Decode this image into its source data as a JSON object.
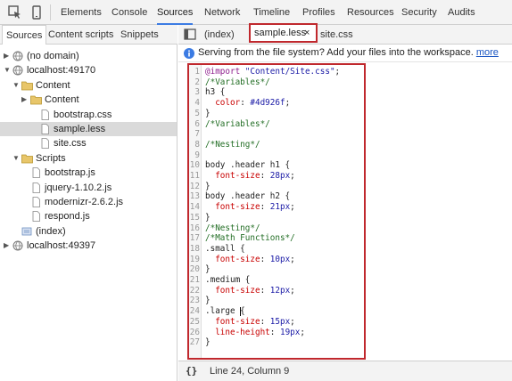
{
  "toolbar": {
    "inspect_icon": "inspect-element-icon",
    "device_icon": "device-mode-icon",
    "tabs": [
      "Elements",
      "Console",
      "Sources",
      "Network",
      "Timeline",
      "Profiles",
      "Resources",
      "Security",
      "Audits"
    ],
    "active_tab": "Sources"
  },
  "navigator": {
    "tabs": [
      "Sources",
      "Content scripts",
      "Snippets"
    ],
    "active_tab": "Sources",
    "tree": [
      {
        "label": "(no domain)",
        "icon": "cloud-icon",
        "arrow": "right"
      },
      {
        "label": "localhost:49170",
        "icon": "cloud-icon",
        "arrow": "down"
      },
      {
        "label": "Content",
        "icon": "folder-icon",
        "arrow": "down"
      },
      {
        "label": "Content",
        "icon": "folder-icon",
        "arrow": "right"
      },
      {
        "label": "bootstrap.css",
        "icon": "file-icon",
        "arrow": ""
      },
      {
        "label": "sample.less",
        "icon": "file-icon",
        "arrow": "",
        "selected": true
      },
      {
        "label": "site.css",
        "icon": "file-icon",
        "arrow": ""
      },
      {
        "label": "Scripts",
        "icon": "folder-icon",
        "arrow": "down"
      },
      {
        "label": "bootstrap.js",
        "icon": "file-icon",
        "arrow": ""
      },
      {
        "label": "jquery-1.10.2.js",
        "icon": "file-icon",
        "arrow": ""
      },
      {
        "label": "modernizr-2.6.2.js",
        "icon": "file-icon",
        "arrow": ""
      },
      {
        "label": "respond.js",
        "icon": "file-icon",
        "arrow": ""
      },
      {
        "label": "(index)",
        "icon": "document-icon",
        "arrow": ""
      },
      {
        "label": "localhost:49397",
        "icon": "cloud-icon",
        "arrow": "right"
      }
    ]
  },
  "editor": {
    "toggle_icon": "toggle-navigator-icon",
    "tabs": [
      {
        "label": "(index)"
      },
      {
        "label": "sample.less",
        "close": "×",
        "active": true
      },
      {
        "label": "site.css"
      }
    ],
    "info_icon": "info-icon",
    "info_text": "Serving from the file system? Add your files into the workspace.",
    "info_link": "more",
    "lines": [
      [
        {
          "t": "@import",
          "c": "at"
        },
        {
          "t": " ",
          "c": "sel"
        },
        {
          "t": "\"Content/Site.css\"",
          "c": "str"
        },
        {
          "t": ";",
          "c": "sel"
        }
      ],
      [
        {
          "t": "/*Variables*/",
          "c": "com"
        }
      ],
      [
        {
          "t": "h3 {",
          "c": "sel"
        }
      ],
      [
        {
          "t": "  color",
          "c": "prop"
        },
        {
          "t": ": ",
          "c": "sel"
        },
        {
          "t": "#4d926f",
          "c": "val"
        },
        {
          "t": ";",
          "c": "sel"
        }
      ],
      [
        {
          "t": "}",
          "c": "sel"
        }
      ],
      [
        {
          "t": "/*Variables*/",
          "c": "com"
        }
      ],
      [],
      [
        {
          "t": "/*Nesting*/",
          "c": "com"
        }
      ],
      [],
      [
        {
          "t": "body .header h1 {",
          "c": "sel"
        }
      ],
      [
        {
          "t": "  font-size",
          "c": "prop"
        },
        {
          "t": ": ",
          "c": "sel"
        },
        {
          "t": "28px",
          "c": "val"
        },
        {
          "t": ";",
          "c": "sel"
        }
      ],
      [
        {
          "t": "}",
          "c": "sel"
        }
      ],
      [
        {
          "t": "body .header h2 {",
          "c": "sel"
        }
      ],
      [
        {
          "t": "  font-size",
          "c": "prop"
        },
        {
          "t": ": ",
          "c": "sel"
        },
        {
          "t": "21px",
          "c": "val"
        },
        {
          "t": ";",
          "c": "sel"
        }
      ],
      [
        {
          "t": "}",
          "c": "sel"
        }
      ],
      [
        {
          "t": "/*Nesting*/",
          "c": "com"
        }
      ],
      [
        {
          "t": "/*Math Functions*/",
          "c": "com"
        }
      ],
      [
        {
          "t": ".small {",
          "c": "sel"
        }
      ],
      [
        {
          "t": "  font-size",
          "c": "prop"
        },
        {
          "t": ": ",
          "c": "sel"
        },
        {
          "t": "10px",
          "c": "val"
        },
        {
          "t": ";",
          "c": "sel"
        }
      ],
      [
        {
          "t": "}",
          "c": "sel"
        }
      ],
      [
        {
          "t": ".medium {",
          "c": "sel"
        }
      ],
      [
        {
          "t": "  font-size",
          "c": "prop"
        },
        {
          "t": ": ",
          "c": "sel"
        },
        {
          "t": "12px",
          "c": "val"
        },
        {
          "t": ";",
          "c": "sel"
        }
      ],
      [
        {
          "t": "}",
          "c": "sel"
        }
      ],
      [
        {
          "t": ".large {",
          "c": "sel"
        }
      ],
      [
        {
          "t": "  font-size",
          "c": "prop"
        },
        {
          "t": ": ",
          "c": "sel"
        },
        {
          "t": "15px",
          "c": "val"
        },
        {
          "t": ";",
          "c": "sel"
        }
      ],
      [
        {
          "t": "  line-height",
          "c": "prop"
        },
        {
          "t": ": ",
          "c": "sel"
        },
        {
          "t": "19px",
          "c": "val"
        },
        {
          "t": ";",
          "c": "sel"
        }
      ],
      [
        {
          "t": "}",
          "c": "sel"
        }
      ]
    ],
    "cursor_line": 24
  },
  "status": {
    "braces": "{}",
    "position": "Line 24, Column 9"
  },
  "colors": {
    "accent": "#3b7be3",
    "highlight_box": "#c0282d",
    "link": "#1a55c2"
  }
}
